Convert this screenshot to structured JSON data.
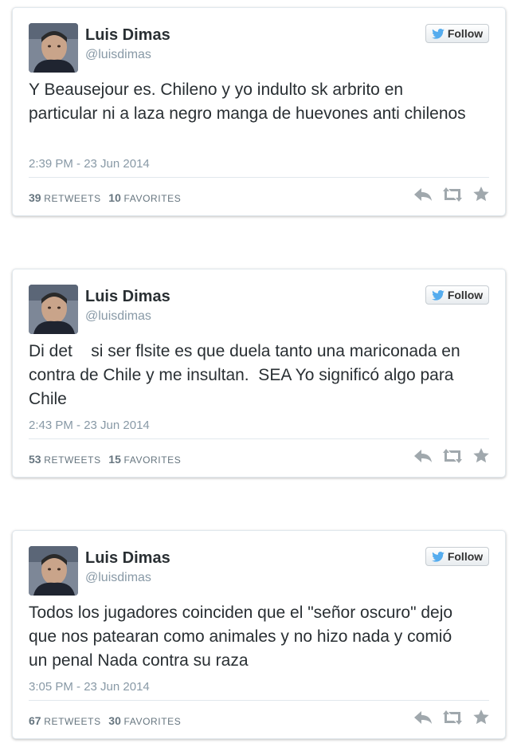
{
  "tweets": [
    {
      "name": "Luis Dimas",
      "handle": "@luisdimas",
      "follow_label": "Follow",
      "text": "Y Beausejour es. Chileno y yo indulto sk arbrito en particular ni a laza negro manga de huevones anti chilenos",
      "timestamp": "2:39 PM - 23 Jun 2014",
      "retweets": "39",
      "retweets_label": "RETWEETS",
      "favorites": "10",
      "favorites_label": "FAVORITES"
    },
    {
      "name": "Luis Dimas",
      "handle": "@luisdimas",
      "follow_label": "Follow",
      "text": "Di det    si ser flsite es que duela tanto una mariconada en contra de Chile y me insultan.  SEA Yo significó algo para Chile",
      "timestamp": "2:43 PM - 23 Jun 2014",
      "retweets": "53",
      "retweets_label": "RETWEETS",
      "favorites": "15",
      "favorites_label": "FAVORITES"
    },
    {
      "name": "Luis Dimas",
      "handle": "@luisdimas",
      "follow_label": "Follow",
      "text": "Todos los jugadores coinciden que el \"señor oscuro\" dejo que nos patearan como animales y no hizo nada y comió un penal Nada contra su raza",
      "timestamp": "3:05 PM - 23 Jun 2014",
      "retweets": "67",
      "retweets_label": "RETWEETS",
      "favorites": "30",
      "favorites_label": "FAVORITES"
    }
  ],
  "icons": {
    "follow": "twitter-bird-icon",
    "reply": "reply-icon",
    "retweet": "retweet-icon",
    "favorite": "star-icon"
  },
  "colors": {
    "twitter_blue": "#55acee",
    "muted_text": "#8899a6",
    "action_icon": "#a0a8ad"
  }
}
